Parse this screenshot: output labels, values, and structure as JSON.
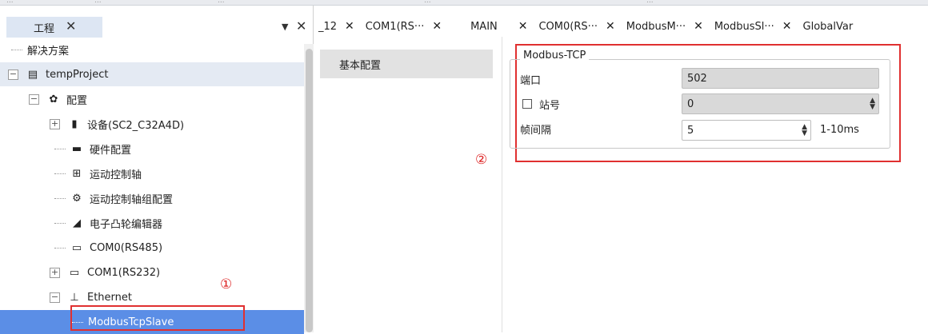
{
  "top_strip": [
    "...",
    "...",
    "...",
    "...",
    "..."
  ],
  "project_panel": {
    "tab_label": "工程",
    "close_glyph": "✕",
    "pin_glyph": "▼",
    "tree": [
      {
        "label": "解决方案",
        "icon": ""
      },
      {
        "label": "tempProject",
        "icon": "document-icon"
      },
      {
        "label": "配置",
        "icon": "gear-icon"
      },
      {
        "label": "设备(SC2_C32A4D)",
        "icon": "device-icon"
      },
      {
        "label": "硬件配置",
        "icon": "hardware-icon"
      },
      {
        "label": "运动控制轴",
        "icon": "axis-icon"
      },
      {
        "label": "运动控制轴组配置",
        "icon": "axis-group-icon"
      },
      {
        "label": "电子凸轮编辑器",
        "icon": "cam-icon"
      },
      {
        "label": "COM0(RS485)",
        "icon": "serial-port-icon"
      },
      {
        "label": "COM1(RS232)",
        "icon": "serial-port-icon"
      },
      {
        "label": "Ethernet",
        "icon": "network-icon"
      },
      {
        "label": "ModbusTcpSlave",
        "icon": ""
      }
    ]
  },
  "annotations": {
    "one": "①",
    "two": "②"
  },
  "tabs": [
    {
      "label": "_12"
    },
    {
      "label": "COM1(RS···"
    },
    {
      "label": "MAIN"
    },
    {
      "label": "COM0(RS···"
    },
    {
      "label": "ModbusM···"
    },
    {
      "label": "ModbusSl···"
    },
    {
      "label": "GlobalVar"
    }
  ],
  "config": {
    "nav_item": "基本配置",
    "group_title": "Modbus-TCP",
    "port_label": "端口",
    "port_value": "502",
    "station_label": "站号",
    "station_value": "0",
    "station_checked": false,
    "interval_label": "帧间隔",
    "interval_value": "5",
    "interval_range": "1-10ms"
  },
  "colors": {
    "selection": "#5b8ee6",
    "annotation": "#e03030"
  }
}
